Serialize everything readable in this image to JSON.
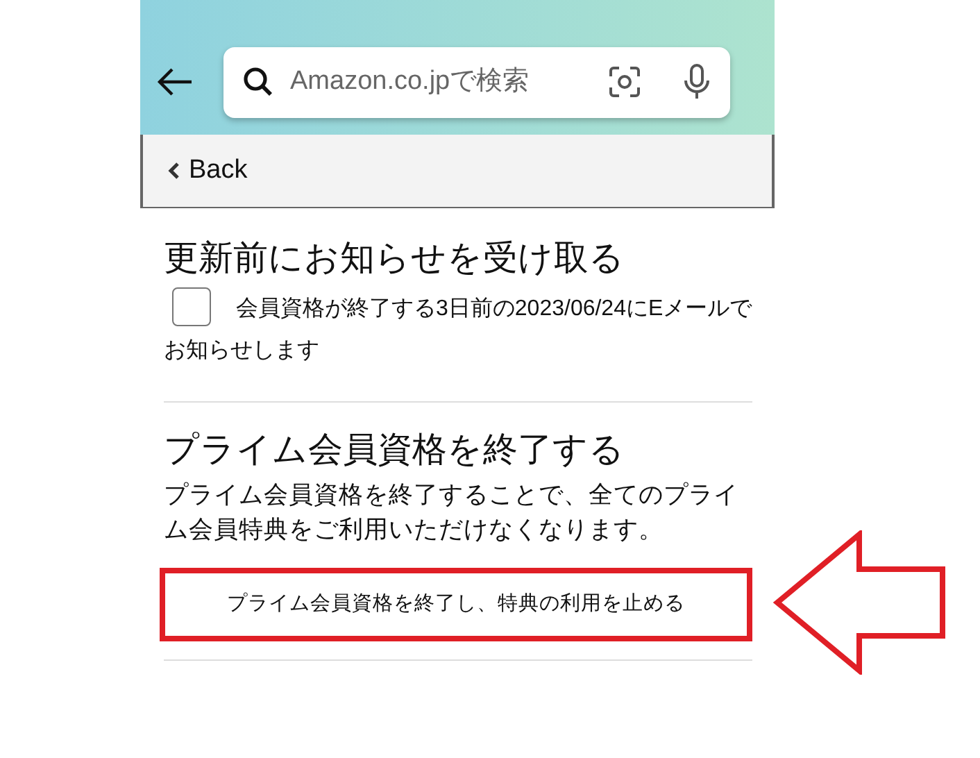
{
  "search": {
    "placeholder": "Amazon.co.jpで検索"
  },
  "back": {
    "label": "Back"
  },
  "reminder": {
    "title": "更新前にお知らせを受け取る",
    "checked": false,
    "label": "会員資格が終了する3日前の2023/06/24にEメールでお知らせします"
  },
  "end_membership": {
    "title": "プライム会員資格を終了する",
    "description": "プライム会員資格を終了することで、全てのプライム会員特典をご利用いただけなくなります。",
    "button": "プライム会員資格を終了し、特典の利用を止める"
  },
  "annotations": {
    "highlight_box": true,
    "arrow": true
  }
}
